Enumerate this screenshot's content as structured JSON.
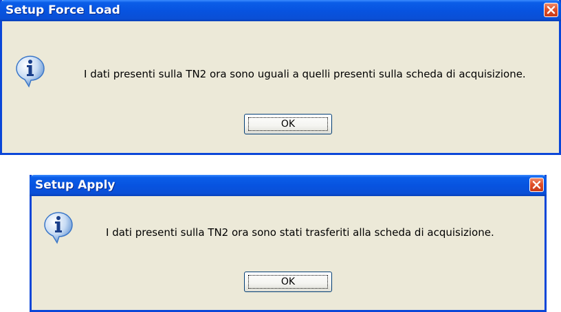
{
  "dialogs": [
    {
      "title": "Setup Force Load",
      "message": "I dati presenti sulla TN2 ora sono uguali a quelli presenti sulla scheda di acquisizione.",
      "ok_label": "OK"
    },
    {
      "title": "Setup Apply",
      "message": "I dati presenti sulla TN2 ora sono stati trasferiti alla scheda di acquisizione.",
      "ok_label": "OK"
    }
  ],
  "icons": {
    "info": "info-icon",
    "close": "close-icon"
  },
  "colors": {
    "titlebar": "#0a4fd6",
    "dialog_bg": "#ece9d8",
    "close_button": "#e0502a",
    "info_icon": "#3a76c8"
  }
}
